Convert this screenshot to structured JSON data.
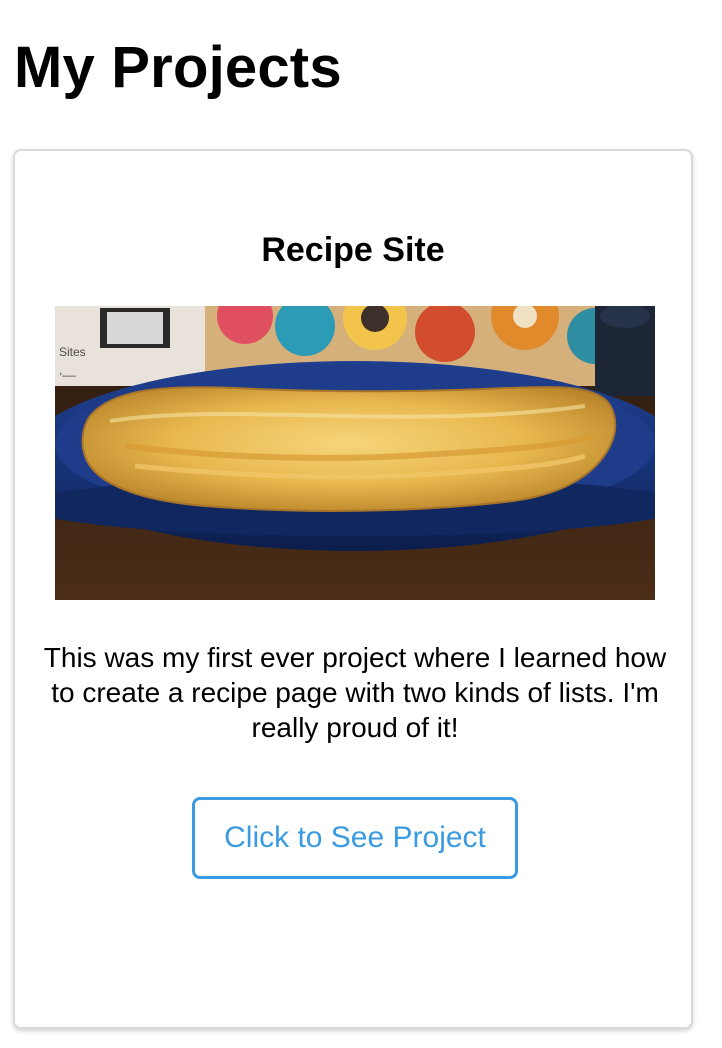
{
  "page": {
    "title": "My Projects"
  },
  "project_card": {
    "title": "Recipe Site",
    "image_subject": "omelette-on-blue-plate",
    "description": "This was my first ever project where I learned how to create a recipe page with two kinds of lists. I'm really proud of it!",
    "button_label": "Click to See Project"
  },
  "colors": {
    "accent": "#3a9be0",
    "card_border": "#d9d9d9",
    "text": "#000000"
  }
}
